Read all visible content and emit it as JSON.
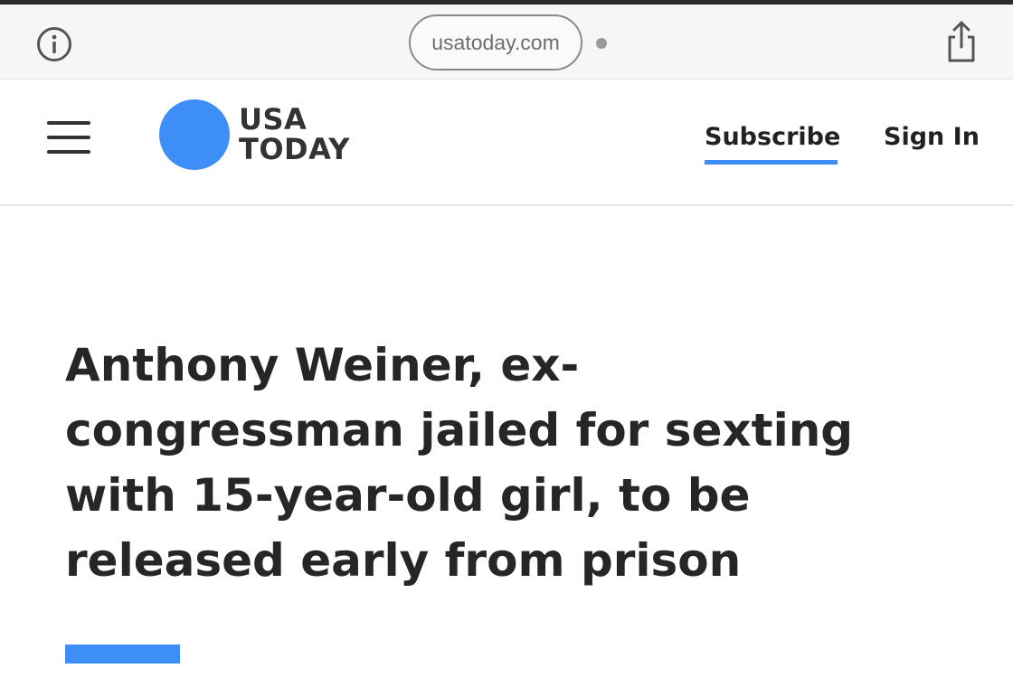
{
  "browser": {
    "url": "usatoday.com",
    "info_icon": "info-icon",
    "share_icon": "share-icon"
  },
  "header": {
    "menu_icon": "hamburger-menu-icon",
    "logo_line1": "USA",
    "logo_line2": "TODAY",
    "subscribe_label": "Subscribe",
    "signin_label": "Sign In"
  },
  "article": {
    "headline_lines": [
      "Anthony Weiner, ex-",
      "congressman jailed for sexting",
      "with 15-year-old girl, to be",
      "released early from prison"
    ]
  },
  "colors": {
    "brand_blue": "#3d8ef7",
    "text_dark": "#262626",
    "browser_bar": "#f6f6f6"
  }
}
